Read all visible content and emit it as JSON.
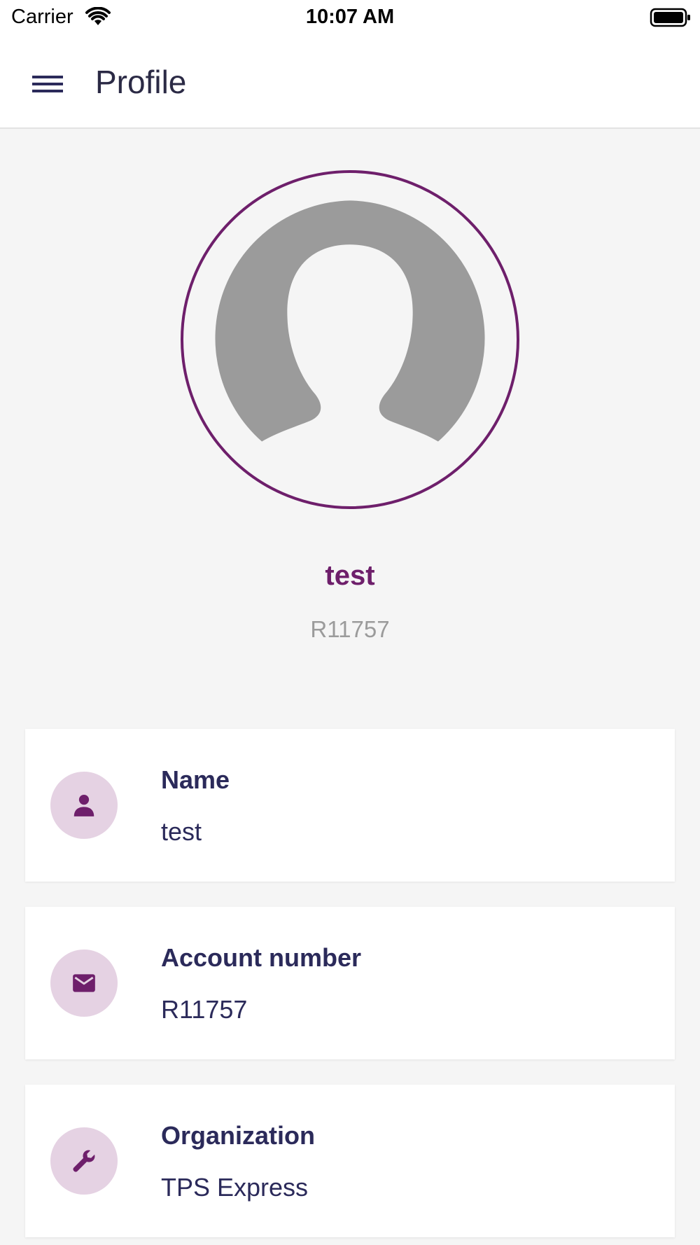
{
  "status_bar": {
    "carrier": "Carrier",
    "time": "10:07 AM"
  },
  "header": {
    "title": "Profile",
    "menu_icon": "hamburger-menu-icon"
  },
  "profile": {
    "name": "test",
    "account": "R11757",
    "avatar_icon": "user-silhouette-icon"
  },
  "details": [
    {
      "label": "Name",
      "value": "test",
      "icon": "person-icon"
    },
    {
      "label": "Account number",
      "value": "R11757",
      "icon": "envelope-icon"
    },
    {
      "label": "Organization",
      "value": "TPS Express",
      "icon": "wrench-icon"
    }
  ],
  "colors": {
    "accent": "#6e1f6b",
    "text_dark": "#2b2a5a",
    "icon_bg": "#e5d2e3",
    "background": "#f5f5f5",
    "muted": "#9b9b9b"
  }
}
